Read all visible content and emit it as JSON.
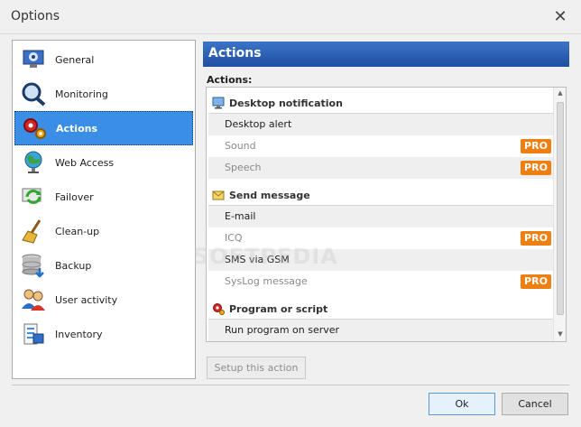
{
  "window": {
    "title": "Options"
  },
  "sidebar": {
    "items": [
      {
        "label": "General",
        "icon": "gear-computer-icon",
        "active": false
      },
      {
        "label": "Monitoring",
        "icon": "magnifier-icon",
        "active": false
      },
      {
        "label": "Actions",
        "icon": "gears-icon",
        "active": true
      },
      {
        "label": "Web Access",
        "icon": "globe-icon",
        "active": false
      },
      {
        "label": "Failover",
        "icon": "failover-arrows-icon",
        "active": false
      },
      {
        "label": "Clean-up",
        "icon": "broom-icon",
        "active": false
      },
      {
        "label": "Backup",
        "icon": "database-icon",
        "active": false
      },
      {
        "label": "User activity",
        "icon": "users-icon",
        "active": false
      },
      {
        "label": "Inventory",
        "icon": "inventory-icon",
        "active": false
      }
    ]
  },
  "panel": {
    "header": "Actions",
    "actions_label": "Actions:",
    "groups": [
      {
        "label": "Desktop notification",
        "icon": "monitor-icon",
        "rows": [
          {
            "label": "Desktop alert",
            "enabled": true,
            "pro": ""
          },
          {
            "label": "Sound",
            "enabled": false,
            "pro": "PRO"
          },
          {
            "label": "Speech",
            "enabled": false,
            "pro": "PRO"
          }
        ]
      },
      {
        "label": "Send message",
        "icon": "envelope-icon",
        "rows": [
          {
            "label": "E-mail",
            "enabled": true,
            "pro": ""
          },
          {
            "label": "ICQ",
            "enabled": false,
            "pro": "PRO"
          },
          {
            "label": "SMS via GSM",
            "enabled": true,
            "pro": ""
          },
          {
            "label": "SysLog message",
            "enabled": false,
            "pro": "PRO"
          }
        ]
      },
      {
        "label": "Program or script",
        "icon": "script-gear-icon",
        "rows": [
          {
            "label": "Run program on server",
            "enabled": true,
            "pro": ""
          }
        ]
      }
    ],
    "setup_button": "Setup this action"
  },
  "footer": {
    "ok_label": "Ok",
    "cancel_label": "Cancel"
  },
  "watermark": "SOFTPEDIA",
  "colors": {
    "accent": "#3a8ee6",
    "header_blue": "#2a5db0",
    "pro_orange": "#f07f12"
  }
}
